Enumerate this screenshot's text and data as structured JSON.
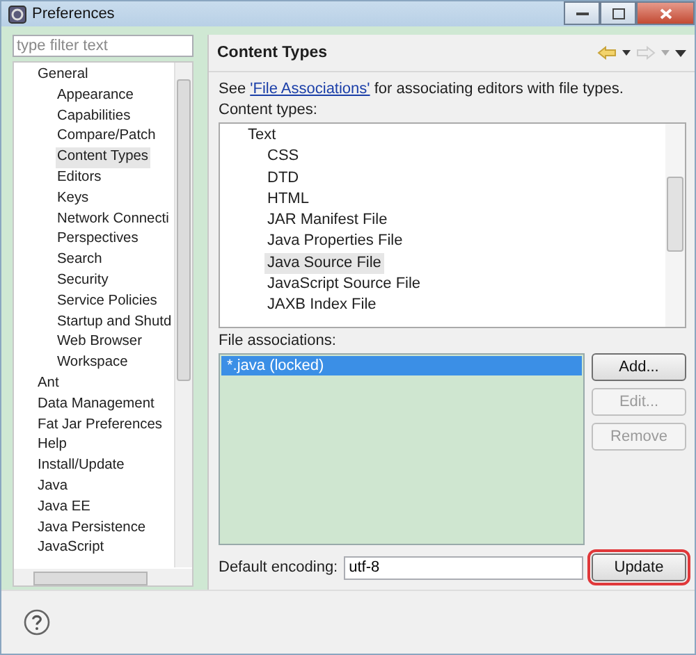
{
  "window": {
    "title": "Preferences"
  },
  "filter": {
    "placeholder": "type filter text"
  },
  "sidebar": {
    "items": [
      {
        "label": "General",
        "selected": false,
        "children": [
          {
            "label": "Appearance",
            "selected": false
          },
          {
            "label": "Capabilities",
            "selected": false
          },
          {
            "label": "Compare/Patch",
            "selected": false
          },
          {
            "label": "Content Types",
            "selected": true
          },
          {
            "label": "Editors",
            "selected": false
          },
          {
            "label": "Keys",
            "selected": false
          },
          {
            "label": "Network Connecti",
            "selected": false
          },
          {
            "label": "Perspectives",
            "selected": false
          },
          {
            "label": "Search",
            "selected": false
          },
          {
            "label": "Security",
            "selected": false
          },
          {
            "label": "Service Policies",
            "selected": false
          },
          {
            "label": "Startup and Shutd",
            "selected": false
          },
          {
            "label": "Web Browser",
            "selected": false
          },
          {
            "label": "Workspace",
            "selected": false
          }
        ]
      },
      {
        "label": "Ant",
        "selected": false
      },
      {
        "label": "Data Management",
        "selected": false
      },
      {
        "label": "Fat Jar Preferences",
        "selected": false
      },
      {
        "label": "Help",
        "selected": false
      },
      {
        "label": "Install/Update",
        "selected": false
      },
      {
        "label": "Java",
        "selected": false
      },
      {
        "label": "Java EE",
        "selected": false
      },
      {
        "label": "Java Persistence",
        "selected": false
      },
      {
        "label": "JavaScript",
        "selected": false
      }
    ]
  },
  "page": {
    "title": "Content Types",
    "intro_before": "See ",
    "intro_link": "'File Associations'",
    "intro_after": " for associating editors with file types.",
    "content_types_label": "Content types:",
    "content_types": [
      {
        "label": "Text",
        "selected": false,
        "children": [
          {
            "label": "CSS",
            "selected": false
          },
          {
            "label": "DTD",
            "selected": false
          },
          {
            "label": "HTML",
            "selected": false
          },
          {
            "label": "JAR Manifest File",
            "selected": false
          },
          {
            "label": "Java Properties File",
            "selected": false
          },
          {
            "label": "Java Source File",
            "selected": true
          },
          {
            "label": "JavaScript Source File",
            "selected": false
          },
          {
            "label": "JAXB Index File",
            "selected": false
          }
        ]
      }
    ],
    "file_associations_label": "File associations:",
    "file_associations": [
      {
        "label": "*.java (locked)",
        "selected": true
      }
    ],
    "buttons": [
      {
        "label": "Add...",
        "disabled": false
      },
      {
        "label": "Edit...",
        "disabled": true
      },
      {
        "label": "Remove",
        "disabled": true
      }
    ],
    "encoding_label": "Default encoding:",
    "encoding_value": "utf-8",
    "update_button": {
      "label": "Update",
      "highlighted": true
    }
  }
}
